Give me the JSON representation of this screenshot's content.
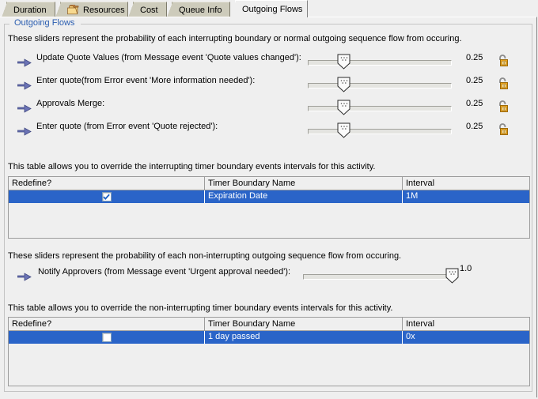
{
  "tabs": [
    {
      "label": "Duration",
      "icon": null,
      "selected": false
    },
    {
      "label": "Resources",
      "icon": "folder-icon",
      "selected": false
    },
    {
      "label": "Cost",
      "icon": null,
      "selected": false
    },
    {
      "label": "Queue Info",
      "icon": null,
      "selected": false
    },
    {
      "label": "Outgoing Flows",
      "icon": null,
      "selected": true
    }
  ],
  "group": {
    "title": "Outgoing Flows"
  },
  "interrupting": {
    "description": "These sliders represent the probability of each interrupting boundary or normal outgoing sequence flow from occuring.",
    "sliders": [
      {
        "label": "Update Quote Values (from Message event 'Quote values changed'):",
        "value": "0.25",
        "fraction": 0.25,
        "lock": "unlocked-padlock-icon"
      },
      {
        "label": "Enter quote(from Error event 'More information needed'):",
        "value": "0.25",
        "fraction": 0.25,
        "lock": "unlocked-padlock-icon"
      },
      {
        "label": "Approvals Merge:",
        "value": "0.25",
        "fraction": 0.25,
        "lock": "unlocked-padlock-icon"
      },
      {
        "label": "Enter quote (from Error event 'Quote rejected'):",
        "value": "0.25",
        "fraction": 0.25,
        "lock": "unlocked-padlock-icon"
      }
    ],
    "table_description": "This table allows you to override the interrupting timer boundary events intervals for this activity.",
    "table": {
      "columns": [
        "Redefine?",
        "Timer Boundary Name",
        "Interval"
      ],
      "rows": [
        {
          "redefine": true,
          "timer_boundary_name": "Expiration Date",
          "interval": "1M",
          "selected": true
        }
      ]
    }
  },
  "non_interrupting": {
    "description": "These sliders represent the probability of each non-interrupting outgoing sequence flow from occuring.",
    "sliders": [
      {
        "label": "Notify Approvers (from Message event 'Urgent approval needed'):",
        "value": "1.0",
        "fraction": 1.0,
        "lock": null
      }
    ],
    "table_description": "This table allows you to override the non-interrupting timer boundary events intervals for this activity.",
    "table": {
      "columns": [
        "Redefine?",
        "Timer Boundary Name",
        "Interval"
      ],
      "rows": [
        {
          "redefine": false,
          "timer_boundary_name": "1 day passed",
          "interval": "0x",
          "selected": true
        }
      ]
    }
  },
  "colors": {
    "selection_blue": "#2a64c8",
    "group_title_blue": "#2a5db0",
    "panel_bg": "#efefef",
    "tab_bg": "#cdcbbb",
    "lock_gold": "#f0a81e"
  }
}
